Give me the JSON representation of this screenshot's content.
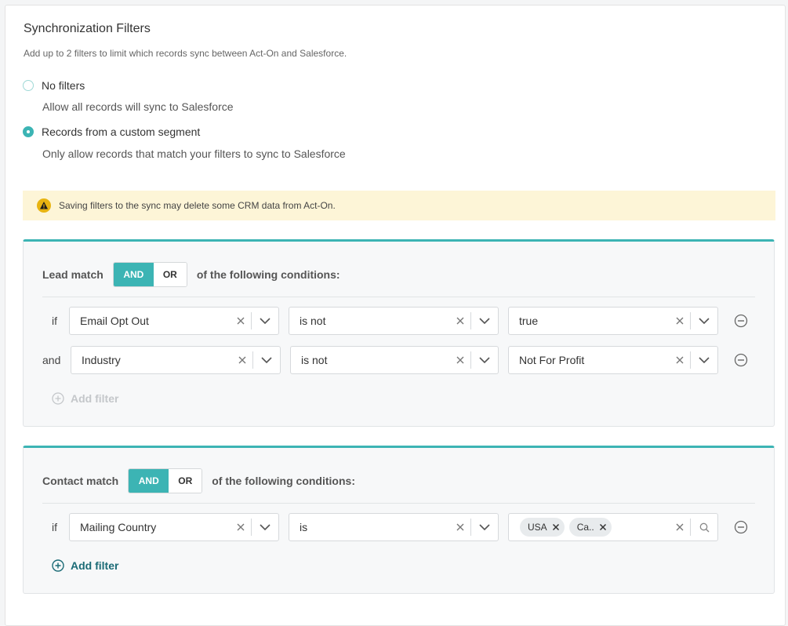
{
  "header": {
    "title": "Synchronization Filters",
    "subtitle": "Add up to 2 filters to limit which records sync between Act-On and Salesforce."
  },
  "options": [
    {
      "label": "No filters",
      "description": "Allow all records will sync to Salesforce",
      "selected": false
    },
    {
      "label": "Records from a custom segment",
      "description": "Only allow records that match your filters to sync to Salesforce",
      "selected": true
    }
  ],
  "warning": {
    "text": "Saving filters to the sync may delete some CRM data from Act-On.",
    "icon": "warning-icon"
  },
  "lead_group": {
    "prefix": "Lead match",
    "and_label": "AND",
    "or_label": "OR",
    "selected": "AND",
    "suffix": "of the following conditions:",
    "rows": [
      {
        "conj": "if",
        "field": "Email Opt Out",
        "operator": "is not",
        "value": "true"
      },
      {
        "conj": "and",
        "field": "Industry",
        "operator": "is not",
        "value": "Not For Profit"
      }
    ],
    "add_label": "Add filter",
    "add_enabled": false
  },
  "contact_group": {
    "prefix": "Contact match",
    "and_label": "AND",
    "or_label": "OR",
    "selected": "AND",
    "suffix": "of the following conditions:",
    "rows": [
      {
        "conj": "if",
        "field": "Mailing Country",
        "operator": "is",
        "chips": [
          "USA",
          "Ca.."
        ]
      }
    ],
    "add_label": "Add filter",
    "add_enabled": true
  },
  "colors": {
    "accent": "#3cb4b4",
    "warning_bg": "#fdf5d7",
    "warning_icon": "#e8b411",
    "link": "#1b6b76"
  }
}
